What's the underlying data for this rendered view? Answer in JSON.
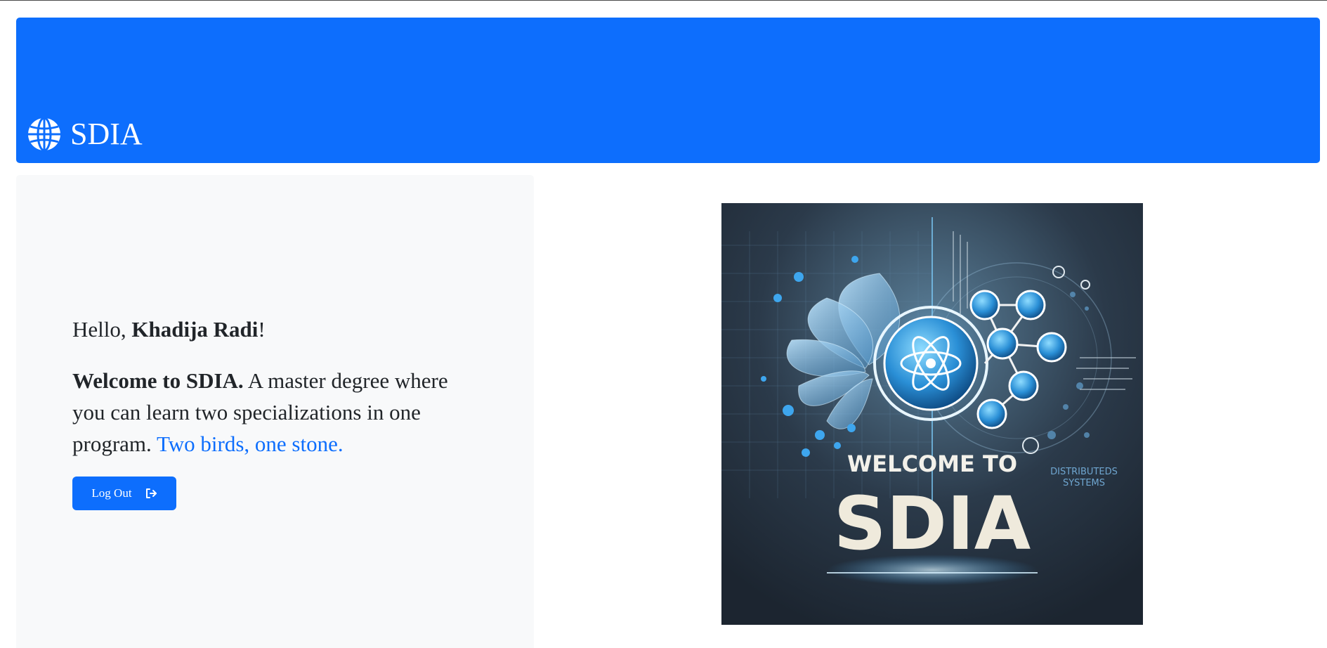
{
  "header": {
    "brand": {
      "icon": "globe-icon",
      "title": "SDIA"
    }
  },
  "main": {
    "greeting": {
      "prefix": "Hello, ",
      "name": "Khadija Radi",
      "suffix": "!"
    },
    "intro": {
      "strong": "Welcome to SDIA.",
      "body": " A master degree where you can learn two specializations in one program. ",
      "accent": "Two birds, one stone."
    },
    "logout_button": {
      "label": "Log Out",
      "icon": "logout-icon"
    },
    "hero_image": {
      "headline": "WELCOME TO",
      "title": "SDIA",
      "caption_line1": "DISTRIBUTEDS",
      "caption_line2": "SYSTEMS"
    }
  },
  "colors": {
    "primary": "#0d6efd",
    "panel": "#f8f9fa",
    "text": "#212529",
    "white": "#ffffff"
  }
}
